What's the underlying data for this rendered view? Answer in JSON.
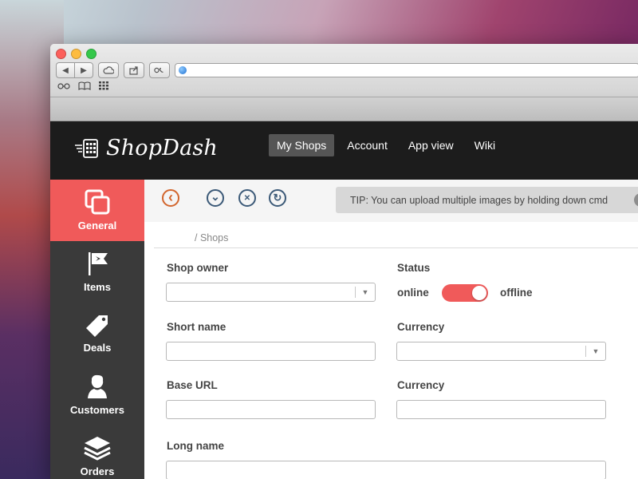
{
  "browser": {
    "url": "",
    "nav_back": "◀",
    "nav_forward": "▶"
  },
  "app": {
    "brand": "ShopDash",
    "topnav": [
      "My Shops",
      "Account",
      "App view",
      "Wiki"
    ],
    "active_topnav": "My Shops"
  },
  "sidebar": {
    "items": [
      {
        "label": "General",
        "icon": "copy-icon",
        "active": true
      },
      {
        "label": "Items",
        "icon": "flag-icon",
        "active": false
      },
      {
        "label": "Deals",
        "icon": "tag-icon",
        "active": false
      },
      {
        "label": "Customers",
        "icon": "user-icon",
        "active": false
      },
      {
        "label": "Orders",
        "icon": "stack-icon",
        "active": false
      }
    ]
  },
  "actions": {
    "back_icon": "‹",
    "down_icon": "⌄",
    "close_icon": "✕",
    "refresh_icon": "↻"
  },
  "tip": {
    "text": "TIP: You can upload multiple images by holding down cmd",
    "close": "✕"
  },
  "breadcrumb": "/ Shops",
  "form": {
    "shop_owner_label": "Shop owner",
    "status_label": "Status",
    "status_online": "online",
    "status_offline": "offline",
    "short_name_label": "Short name",
    "currency_label_1": "Currency",
    "base_url_label": "Base URL",
    "currency_label_2": "Currency",
    "long_name_label": "Long name",
    "caret": "▼"
  },
  "colors": {
    "accent": "#f05a5a",
    "header": "#1c1c1c",
    "sidebar": "#3a3a3a"
  }
}
